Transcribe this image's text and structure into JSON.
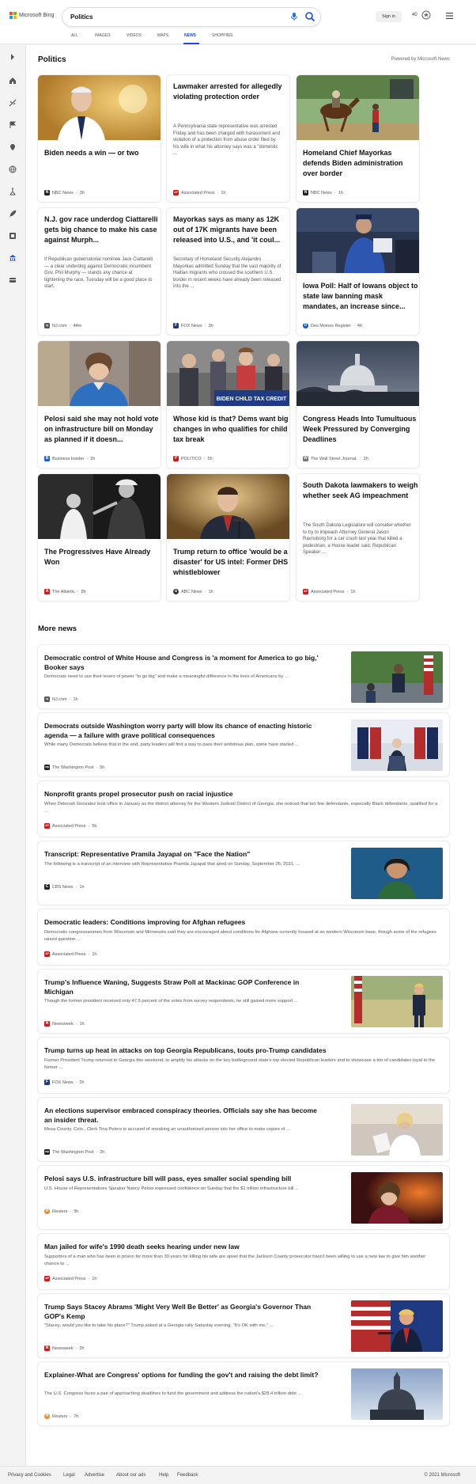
{
  "brand": {
    "name": "Microsoft Bing",
    "colors": [
      "#f25022",
      "#7fba00",
      "#00a4ef",
      "#ffb900"
    ]
  },
  "search": {
    "query": "Politics"
  },
  "header": {
    "signin": "Sign in",
    "rewards": "40"
  },
  "tabs": [
    {
      "label": "ALL"
    },
    {
      "label": "IMAGES"
    },
    {
      "label": "VIDEOS"
    },
    {
      "label": "MAPS"
    },
    {
      "label": "NEWS",
      "active": true
    },
    {
      "label": "SHOPPING"
    }
  ],
  "rail_icons": [
    "expand-icon",
    "home-icon",
    "sports-icon",
    "flag-icon",
    "location-icon",
    "globe-icon",
    "science-icon",
    "rocket-icon",
    "entertainment-icon",
    "politics-icon",
    "money-icon"
  ],
  "page": {
    "title": "Politics",
    "powered": "Powered by Microsoft News"
  },
  "cards": [
    {
      "title": "Biden needs a win — or two",
      "desc": "",
      "source": "NBC News",
      "time": "3h",
      "logo_color": "#222222",
      "logo_char": "N"
    },
    {
      "title": "Lawmaker arrested for allegedly violating protection order",
      "desc": "A Pennsylvania state representative was arrested Friday and has been charged with harassment and violation of a protection from abuse order filed by his wife in what his attorney says was a \"domestic ...",
      "source": "Associated Press",
      "time": "1h",
      "logo_color": "#d11a1a",
      "logo_char": "AP"
    },
    {
      "title": "Homeland Chief Mayorkas defends Biden administration over border",
      "desc": "",
      "source": "NBC News",
      "time": "1h",
      "logo_color": "#222222",
      "logo_char": "N"
    },
    {
      "title": "N.J. gov race underdog Ciattarelli gets big chance to make his case against Murph...",
      "desc": "If Republican gubernatorial nominee Jack Ciattarelli — a clear underdog against Democratic incumbent Gov. Phil Murphy — stands any chance at tightening the race, Tuesday will be a good place to start.",
      "source": "NJ.com",
      "time": "44m",
      "logo_color": "#555555",
      "logo_char": "nj"
    },
    {
      "title": "Mayorkas says as many as 12K out of 17K migrants have been released into U.S., and 'it coul...",
      "desc": "Secretary of Homeland Security Alejandro Mayorkas admitted Sunday that the vast majority of Haitian migrants who crossed the southern U.S. border in recent weeks have already been released into the ...",
      "source": "FOX News",
      "time": "3h",
      "logo_color": "#1b3a7a",
      "logo_char": "F"
    },
    {
      "title": "Iowa Poll: Half of Iowans object to state law banning mask mandates, an increase since...",
      "desc": "",
      "source": "Des Moines Register",
      "time": "4h",
      "logo_color": "#1a57b8",
      "logo_char": "D"
    },
    {
      "title": "Pelosi said she may not hold vote on infrastructure bill on Monday as planned if it doesn...",
      "desc": "",
      "source": "Business Insider",
      "time": "2h",
      "logo_color": "#1f5fd6",
      "logo_char": "B"
    },
    {
      "title": "Whose kid is that? Dems want big changes in who qualifies for child tax break",
      "desc": "",
      "source": "POLITICO",
      "time": "5h",
      "logo_color": "#d11a1a",
      "logo_char": "P"
    },
    {
      "title": "Congress Heads Into Tumultuous Week Pressured by Converging Deadlines",
      "desc": "",
      "source": "The Wall Street Journal.",
      "time": "2h",
      "logo_color": "#777777",
      "logo_char": "W"
    },
    {
      "title": "The Progressives Have Already Won",
      "desc": "",
      "source": "The Atlantic",
      "time": "8h",
      "logo_color": "#d11a1a",
      "logo_char": "A"
    },
    {
      "title": "Trump return to office 'would be a disaster' for US intel: Former DHS whistleblower",
      "desc": "",
      "source": "ABC News",
      "time": "1h",
      "logo_color": "#333333",
      "logo_char": "a"
    },
    {
      "title": "South Dakota lawmakers to weigh whether seek AG impeachment",
      "desc": "The South Dakota Legislature will consider whether to try to impeach Attorney General Jason Ravnsborg for a car crash last year that killed a pedestrian, a House leader said. Republican Speaker ...",
      "source": "Associated Press",
      "time": "1h",
      "logo_color": "#d11a1a",
      "logo_char": "AP"
    }
  ],
  "card_images": {
    "banner_text": "BIDEN CHILD TAX CREDIT"
  },
  "more_news_title": "More news",
  "more": [
    {
      "title": "Democratic control of White House and Congress is 'a moment for America to go big,' Booker says",
      "desc": "Democrats need to use their levers of power \"to go big\" and make a meaningful difference in the lives of Americans by ...",
      "source": "NJ.com",
      "time": "1h",
      "logo_color": "#555555",
      "logo_char": "nj"
    },
    {
      "title": "Democrats outside Washington worry party will blow its chance of enacting historic agenda — a failure with grave political consequences",
      "desc": "While many Democrats believe that in the end, party leaders will find a way to pass their ambitious plan, some have started ...",
      "source": "The Washington Post",
      "time": "5h",
      "logo_color": "#222222",
      "logo_char": "wp"
    },
    {
      "title": "Nonprofit grants propel prosecutor push on racial injustice",
      "desc": "When Deborah Gonzalez took office in January as the district attorney for the Western Judicial District of Georgia, she noticed that too few defendants, especially Black defendants, qualified for a ...",
      "source": "Associated Press",
      "time": "5h",
      "logo_color": "#d11a1a",
      "logo_char": "AP"
    },
    {
      "title": "Transcript: Representative Pramila Jayapal on \"Face the Nation\"",
      "desc": "The following is a transcript of an interview with Representative Pramila Jayapal that aired on Sunday, September 26, 2021, ...",
      "source": "CBS News",
      "time": "1h",
      "logo_color": "#222222",
      "logo_char": "C"
    },
    {
      "title": "Democratic leaders: Conditions improving for Afghan refugees",
      "desc": "Democratic congresswomen from Wisconsin and Minnesota said they are encouraged about conditions for Afghans currently housed at an western Wisconsin base, though some of the refugees raised question ...",
      "source": "Associated Press",
      "time": "1h",
      "logo_color": "#d11a1a",
      "logo_char": "AP"
    },
    {
      "title": "Trump's Influence Waning, Suggests Straw Poll at Mackinac GOP Conference in Michigan",
      "desc": "Though the former president received only 47.5 percent of the votes from survey respondents, he still gained more support ...",
      "source": "Newsweek",
      "time": "1h",
      "logo_color": "#d11a1a",
      "logo_char": "N"
    },
    {
      "title": "Trump turns up heat in attacks on top Georgia Republicans, touts pro-Trump candidates",
      "desc": "Former President Trump returned to Georgia this weekend, to amplify his attacks on the key battleground state's top elected Republican leaders and to showcase a trio of candidates loyal to the former ...",
      "source": "FOX News",
      "time": "2h",
      "logo_color": "#1b3a7a",
      "logo_char": "F"
    },
    {
      "title": "An elections supervisor embraced conspiracy theories. Officials say she has become an insider threat.",
      "desc": "Mesa County, Colo., Clerk Tina Peters is accused of sneaking an unauthorized person into her office to make copies of ...",
      "source": "The Washington Post",
      "time": "2h",
      "logo_color": "#222222",
      "logo_char": "wp"
    },
    {
      "title": "Pelosi says U.S. infrastructure bill will pass, eyes smaller social spending bill",
      "desc": "U.S. House of Representatives Speaker Nancy Pelosi expressed confidence on Sunday that the $1 trillion infrastructure bill ...",
      "source": "Reuters",
      "time": "3h",
      "logo_color": "#f08a24",
      "logo_char": "R"
    },
    {
      "title": "Man jailed for wife's 1990 death seeks hearing under new law",
      "desc": "Supporters of a man who has been in prison for more than 30 years for killing his wife are upset that the Jackson County prosecutor hasn't been willing to use a new law to give him another chance to ...",
      "source": "Associated Press",
      "time": "1h",
      "logo_color": "#d11a1a",
      "logo_char": "AP"
    },
    {
      "title": "Trump Says Stacey Abrams 'Might Very Well Be Better' as Georgia's Governor Than GOP's Kemp",
      "desc": "\"Stacey, would you like to take his place?\" Trump asked at a Georgia rally Saturday evening. \"It's OK with me.\" ...",
      "source": "Newsweek",
      "time": "2h",
      "logo_color": "#d11a1a",
      "logo_char": "N"
    },
    {
      "title": "Explainer-What are Congress' options for funding the gov't and raising the debt limit?",
      "desc": "The U.S. Congress faces a pair of approaching deadlines to fund the government and address the nation's $28.4 trillion debt ...",
      "source": "Reuters",
      "time": "7h",
      "logo_color": "#f08a24",
      "logo_char": "R"
    }
  ],
  "footer": {
    "links": [
      "Privacy and Cookies",
      "Legal",
      "Advertise",
      "About our ads",
      "Help",
      "Feedback"
    ],
    "copyright": "© 2021 Microsoft"
  }
}
